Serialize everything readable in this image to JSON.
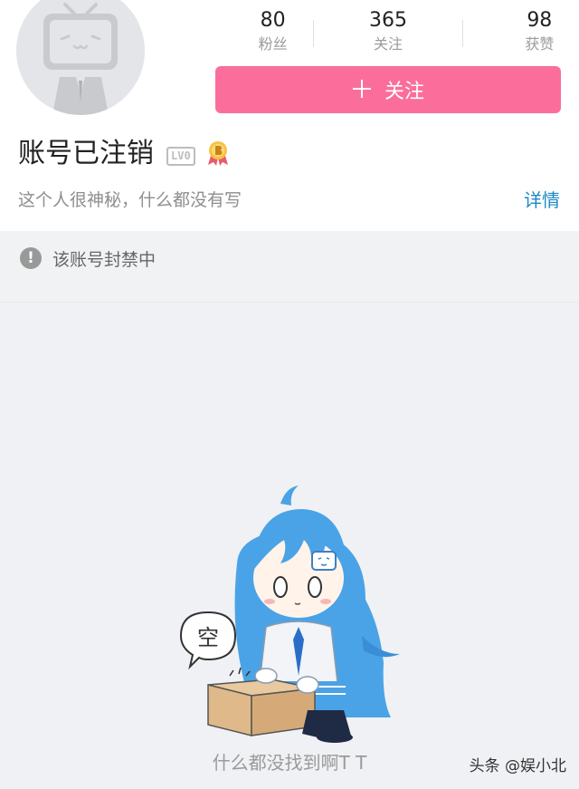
{
  "profile": {
    "name": "账号已注销",
    "level_badge": "LV0",
    "bio": "这个人很神秘，什么都没有写",
    "details_label": "详情"
  },
  "stats": [
    {
      "value": "80",
      "label": "粉丝"
    },
    {
      "value": "365",
      "label": "关注"
    },
    {
      "value": "98",
      "label": "获赞"
    }
  ],
  "follow_button": {
    "icon": "plus-icon",
    "label": "关注"
  },
  "banner": {
    "icon": "exclamation-icon",
    "text": "该账号封禁中"
  },
  "empty_state": {
    "bubble_text": "空",
    "text": "什么都没找到啊T T"
  },
  "watermark": "头条 @娱小北",
  "colors": {
    "follow_pink": "#fb6e9b",
    "link_blue": "#1a89c5",
    "mascot_hair": "#4aa3e6"
  }
}
